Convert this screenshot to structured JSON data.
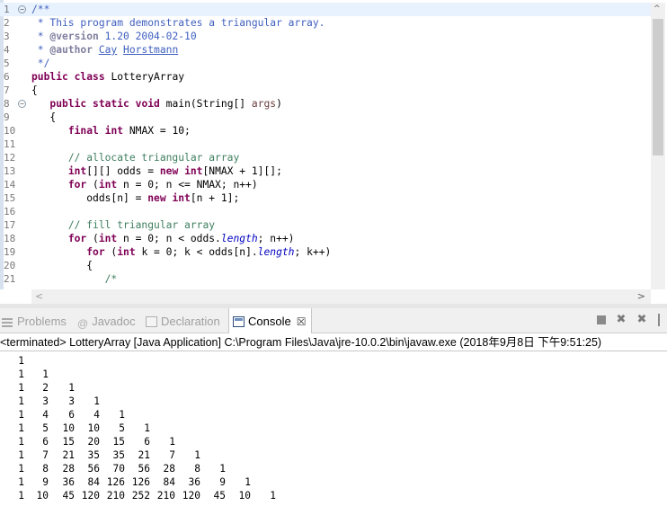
{
  "editor": {
    "lines": [
      {
        "n": "1",
        "fold": "−",
        "tokens": [
          [
            "doc",
            "/**"
          ]
        ]
      },
      {
        "n": "2",
        "tokens": [
          [
            "doc",
            " * This program demonstrates a triangular array."
          ]
        ]
      },
      {
        "n": "3",
        "tokens": [
          [
            "doc",
            " * "
          ],
          [
            "tag",
            "@version"
          ],
          [
            "doc",
            " 1.20 2004-02-10"
          ]
        ]
      },
      {
        "n": "4",
        "tokens": [
          [
            "doc",
            " * "
          ],
          [
            "tag",
            "@author"
          ],
          [
            "doc",
            " "
          ],
          [
            "link",
            "Cay"
          ],
          [
            "doc",
            " "
          ],
          [
            "link",
            "Horstmann"
          ]
        ]
      },
      {
        "n": "5",
        "tokens": [
          [
            "doc",
            " */"
          ]
        ]
      },
      {
        "n": "6",
        "tokens": [
          [
            "kw",
            "public"
          ],
          [
            "plain",
            " "
          ],
          [
            "kw",
            "class"
          ],
          [
            "plain",
            " LotteryArray"
          ]
        ]
      },
      {
        "n": "7",
        "tokens": [
          [
            "plain",
            "{"
          ]
        ]
      },
      {
        "n": "8",
        "fold": "−",
        "tokens": [
          [
            "plain",
            "   "
          ],
          [
            "kw",
            "public"
          ],
          [
            "plain",
            " "
          ],
          [
            "kw",
            "static"
          ],
          [
            "plain",
            " "
          ],
          [
            "kw",
            "void"
          ],
          [
            "plain",
            " main(String[] "
          ],
          [
            "param",
            "args"
          ],
          [
            "plain",
            ")"
          ]
        ]
      },
      {
        "n": "9",
        "tokens": [
          [
            "plain",
            "   {"
          ]
        ]
      },
      {
        "n": "10",
        "tokens": [
          [
            "plain",
            "      "
          ],
          [
            "kw",
            "final"
          ],
          [
            "plain",
            " "
          ],
          [
            "kw",
            "int"
          ],
          [
            "plain",
            " NMAX = 10;"
          ]
        ]
      },
      {
        "n": "11",
        "tokens": [
          [
            "plain",
            ""
          ]
        ]
      },
      {
        "n": "12",
        "tokens": [
          [
            "plain",
            "      "
          ],
          [
            "cm",
            "// allocate triangular array"
          ]
        ]
      },
      {
        "n": "13",
        "tokens": [
          [
            "plain",
            "      "
          ],
          [
            "kw",
            "int"
          ],
          [
            "plain",
            "[][] odds = "
          ],
          [
            "kw",
            "new"
          ],
          [
            "plain",
            " "
          ],
          [
            "kw",
            "int"
          ],
          [
            "plain",
            "[NMAX + 1][];"
          ]
        ]
      },
      {
        "n": "14",
        "tokens": [
          [
            "plain",
            "      "
          ],
          [
            "kw",
            "for"
          ],
          [
            "plain",
            " ("
          ],
          [
            "kw",
            "int"
          ],
          [
            "plain",
            " n = 0; n <= NMAX; n++)"
          ]
        ]
      },
      {
        "n": "15",
        "tokens": [
          [
            "plain",
            "         odds[n] = "
          ],
          [
            "kw",
            "new"
          ],
          [
            "plain",
            " "
          ],
          [
            "kw",
            "int"
          ],
          [
            "plain",
            "[n + 1];"
          ]
        ]
      },
      {
        "n": "16",
        "tokens": [
          [
            "plain",
            ""
          ]
        ]
      },
      {
        "n": "17",
        "tokens": [
          [
            "plain",
            "      "
          ],
          [
            "cm",
            "// fill triangular array"
          ]
        ]
      },
      {
        "n": "18",
        "tokens": [
          [
            "plain",
            "      "
          ],
          [
            "kw",
            "for"
          ],
          [
            "plain",
            " ("
          ],
          [
            "kw",
            "int"
          ],
          [
            "plain",
            " n = 0; n < odds."
          ],
          [
            "fld",
            "length"
          ],
          [
            "plain",
            "; n++)"
          ]
        ]
      },
      {
        "n": "19",
        "tokens": [
          [
            "plain",
            "         "
          ],
          [
            "kw",
            "for"
          ],
          [
            "plain",
            " ("
          ],
          [
            "kw",
            "int"
          ],
          [
            "plain",
            " k = 0; k < odds[n]."
          ],
          [
            "fld",
            "length"
          ],
          [
            "plain",
            "; k++)"
          ]
        ]
      },
      {
        "n": "20",
        "tokens": [
          [
            "plain",
            "         {"
          ]
        ]
      },
      {
        "n": "21",
        "tokens": [
          [
            "plain",
            "            "
          ],
          [
            "cm",
            "/*"
          ]
        ]
      }
    ],
    "current_line": 0,
    "h_scroll_left": "<",
    "h_scroll_right": ">",
    "v_scroll_up": "^"
  },
  "views": {
    "tabs": [
      {
        "id": "problems",
        "label": "Problems",
        "active": false
      },
      {
        "id": "javadoc",
        "label": "Javadoc",
        "icon_glyph": "@",
        "active": false
      },
      {
        "id": "declaration",
        "label": "Declaration",
        "active": false
      },
      {
        "id": "console",
        "label": "Console",
        "active": true,
        "close_glyph": "☒"
      }
    ],
    "toolbar": {
      "remove_glyph": "✖",
      "remove_all_glyph": "✖"
    }
  },
  "console": {
    "header": "<terminated> LotteryArray [Java Application] C:\\Program Files\\Java\\jre-10.0.2\\bin\\javaw.exe (2018年9月8日 下午9:51:25)",
    "rows": [
      [
        "1"
      ],
      [
        "1",
        "1"
      ],
      [
        "1",
        "2",
        "1"
      ],
      [
        "1",
        "3",
        "3",
        "1"
      ],
      [
        "1",
        "4",
        "6",
        "4",
        "1"
      ],
      [
        "1",
        "5",
        "10",
        "10",
        "5",
        "1"
      ],
      [
        "1",
        "6",
        "15",
        "20",
        "15",
        "6",
        "1"
      ],
      [
        "1",
        "7",
        "21",
        "35",
        "35",
        "21",
        "7",
        "1"
      ],
      [
        "1",
        "8",
        "28",
        "56",
        "70",
        "56",
        "28",
        "8",
        "1"
      ],
      [
        "1",
        "9",
        "36",
        "84",
        "126",
        "126",
        "84",
        "36",
        "9",
        "1"
      ],
      [
        "1",
        "10",
        "45",
        "120",
        "210",
        "252",
        "210",
        "120",
        "45",
        "10",
        "1"
      ]
    ]
  },
  "colors": {
    "keyword": "#7f0055",
    "javadoc": "#3f5fbf",
    "comment": "#3f7f5f",
    "field": "#0000c0",
    "current_line": "#e8f2fe"
  }
}
